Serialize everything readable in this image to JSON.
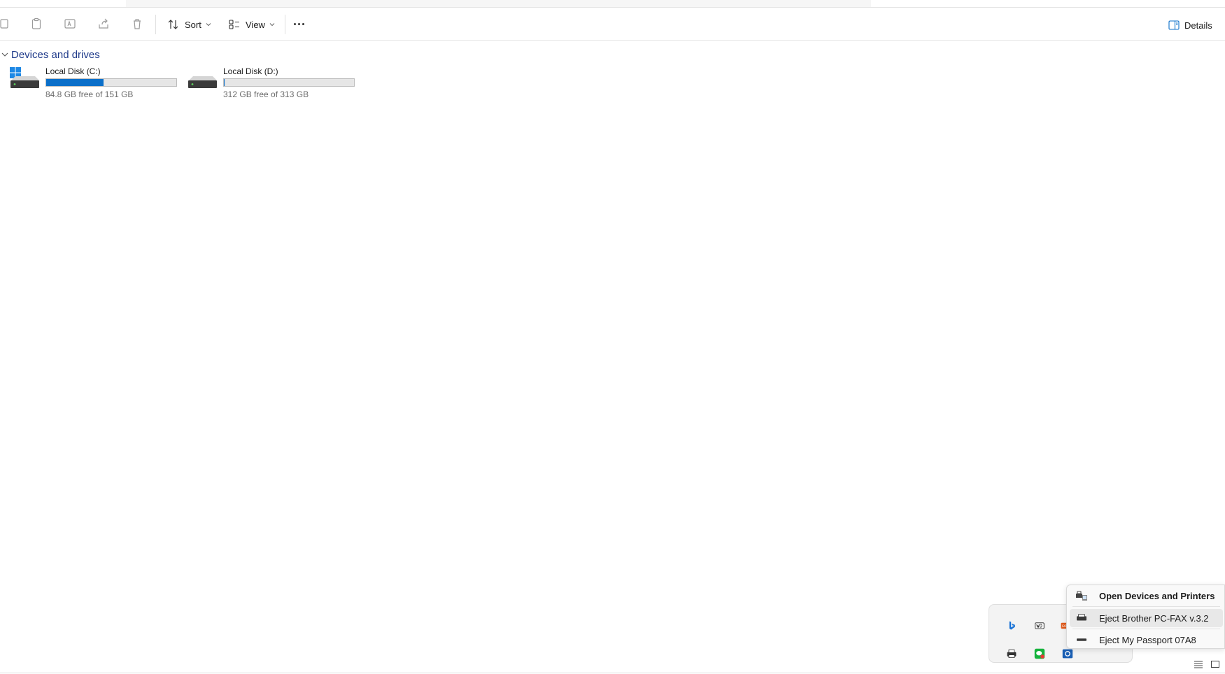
{
  "toolbar": {
    "sort_label": "Sort",
    "view_label": "View",
    "details_label": "Details"
  },
  "section": {
    "title": "Devices and drives"
  },
  "drives": [
    {
      "name": "Local Disk (C:)",
      "free_text": "84.8 GB free of 151 GB",
      "used_fraction": 0.44,
      "icon": "windows-drive-icon"
    },
    {
      "name": "Local Disk (D:)",
      "free_text": "312 GB free of 313 GB",
      "used_fraction": 0.003,
      "icon": "hard-drive-icon"
    }
  ],
  "tray": {
    "icons": [
      "bing-icon",
      "wd-icon",
      "colorful-app-icon",
      "printer-icon",
      "wechat-icon",
      "camera-icon",
      "app-error-icon",
      "edit-icon"
    ]
  },
  "context_menu": {
    "items": [
      {
        "label": "Open Devices and Printers",
        "icon": "devices-printers-icon",
        "bold": true
      },
      {
        "label": "Eject Brother PC-FAX v.3.2",
        "icon": "printer-icon",
        "bold": false,
        "hovered": true
      },
      {
        "label": "Eject My Passport 07A8",
        "icon": "usb-drive-icon",
        "bold": false
      }
    ]
  },
  "colors": {
    "accent": "#0b6fc9",
    "section_title": "#1f3a8a"
  }
}
